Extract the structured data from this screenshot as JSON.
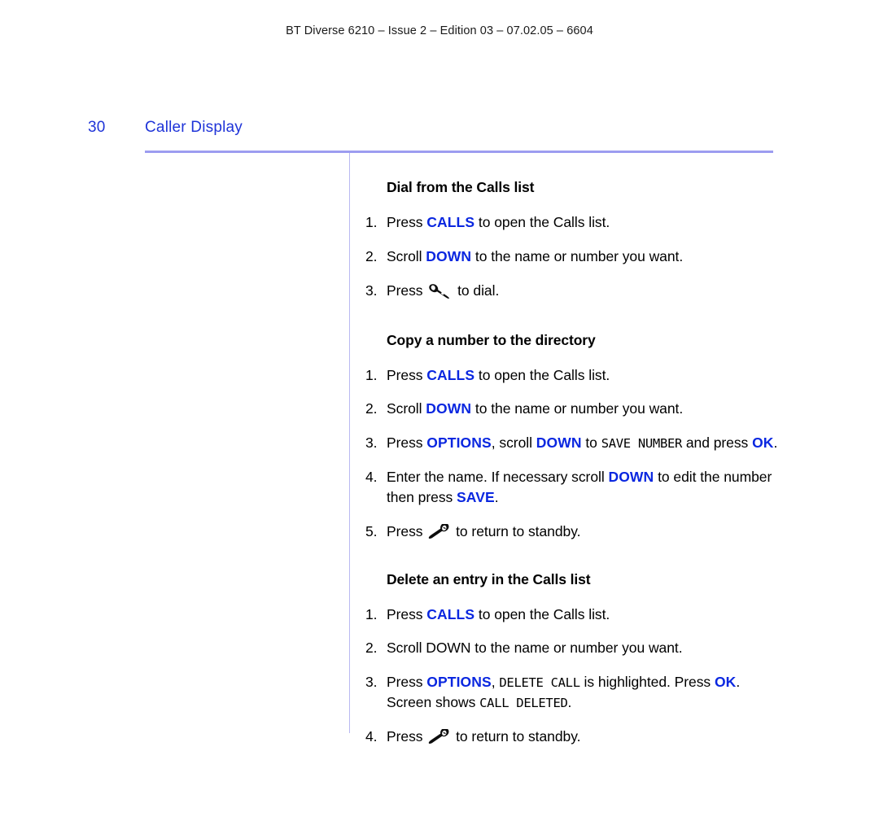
{
  "header": {
    "running_header": "BT Diverse 6210 – Issue 2 – Edition 03 – 07.02.05 – 6604"
  },
  "page": {
    "folio": "30",
    "section_title": "Caller Display"
  },
  "colors": {
    "key_blue": "#0a27e0",
    "heading_blue": "#1f34d8",
    "rule_lavender": "#9c9cf0",
    "divider_lavender": "#b9b9f2",
    "body_black": "#000000"
  },
  "icons": {
    "talk": "talk-handset-icon",
    "end_call": "end-call-handset-icon"
  },
  "sections": [
    {
      "heading": "Dial from the Calls list",
      "steps": [
        {
          "num": "1.",
          "parts": [
            {
              "t": "Press ",
              "s": "plain"
            },
            {
              "t": "CALLS",
              "s": "key"
            },
            {
              "t": " to open the Calls list.",
              "s": "plain"
            }
          ]
        },
        {
          "num": "2.",
          "parts": [
            {
              "t": "Scroll ",
              "s": "plain"
            },
            {
              "t": "DOWN",
              "s": "key"
            },
            {
              "t": " to the name or number you want.",
              "s": "plain"
            }
          ]
        },
        {
          "num": "3.",
          "parts": [
            {
              "t": "Press ",
              "s": "plain"
            },
            {
              "t": "talk-handset-icon",
              "s": "icon"
            },
            {
              "t": " to dial.",
              "s": "plain"
            }
          ]
        }
      ]
    },
    {
      "heading": "Copy a number to the directory",
      "steps": [
        {
          "num": "1.",
          "parts": [
            {
              "t": "Press ",
              "s": "plain"
            },
            {
              "t": "CALLS",
              "s": "key"
            },
            {
              "t": " to open the Calls list.",
              "s": "plain"
            }
          ]
        },
        {
          "num": "2.",
          "parts": [
            {
              "t": "Scroll ",
              "s": "plain"
            },
            {
              "t": "DOWN",
              "s": "key"
            },
            {
              "t": " to the name or number you want.",
              "s": "plain"
            }
          ]
        },
        {
          "num": "3.",
          "parts": [
            {
              "t": "Press ",
              "s": "plain"
            },
            {
              "t": "OPTIONS",
              "s": "key"
            },
            {
              "t": ", scroll ",
              "s": "plain"
            },
            {
              "t": "DOWN",
              "s": "key"
            },
            {
              "t": " to ",
              "s": "plain"
            },
            {
              "t": "SAVE NUMBER",
              "s": "lcd"
            },
            {
              "t": " and press ",
              "s": "plain"
            },
            {
              "t": "OK",
              "s": "key"
            },
            {
              "t": ".",
              "s": "plain"
            }
          ]
        },
        {
          "num": "4.",
          "parts": [
            {
              "t": "Enter the name. If necessary scroll ",
              "s": "plain"
            },
            {
              "t": "DOWN",
              "s": "key"
            },
            {
              "t": " to edit the number then press ",
              "s": "plain"
            },
            {
              "t": "SAVE",
              "s": "key"
            },
            {
              "t": ".",
              "s": "plain"
            }
          ]
        },
        {
          "num": "5.",
          "parts": [
            {
              "t": "Press ",
              "s": "plain"
            },
            {
              "t": "end-call-handset-icon",
              "s": "icon"
            },
            {
              "t": " to return to standby.",
              "s": "plain"
            }
          ]
        }
      ]
    },
    {
      "heading": "Delete an entry in the Calls list",
      "steps": [
        {
          "num": "1.",
          "parts": [
            {
              "t": "Press ",
              "s": "plain"
            },
            {
              "t": "CALLS",
              "s": "key"
            },
            {
              "t": " to open the Calls list.",
              "s": "plain"
            }
          ]
        },
        {
          "num": "2.",
          "parts": [
            {
              "t": "Scroll DOWN to the name or number you want.",
              "s": "plain"
            }
          ]
        },
        {
          "num": "3.",
          "parts": [
            {
              "t": "Press ",
              "s": "plain"
            },
            {
              "t": "OPTIONS",
              "s": "key"
            },
            {
              "t": ", ",
              "s": "plain"
            },
            {
              "t": "DELETE CALL",
              "s": "lcd"
            },
            {
              "t": " is highlighted. Press ",
              "s": "plain"
            },
            {
              "t": "OK",
              "s": "key"
            },
            {
              "t": ". Screen shows ",
              "s": "plain"
            },
            {
              "t": "CALL DELETED",
              "s": "lcd"
            },
            {
              "t": ".",
              "s": "plain"
            }
          ]
        },
        {
          "num": "4.",
          "parts": [
            {
              "t": "Press ",
              "s": "plain"
            },
            {
              "t": "end-call-handset-icon",
              "s": "icon"
            },
            {
              "t": " to return to standby.",
              "s": "plain"
            }
          ]
        }
      ]
    }
  ]
}
